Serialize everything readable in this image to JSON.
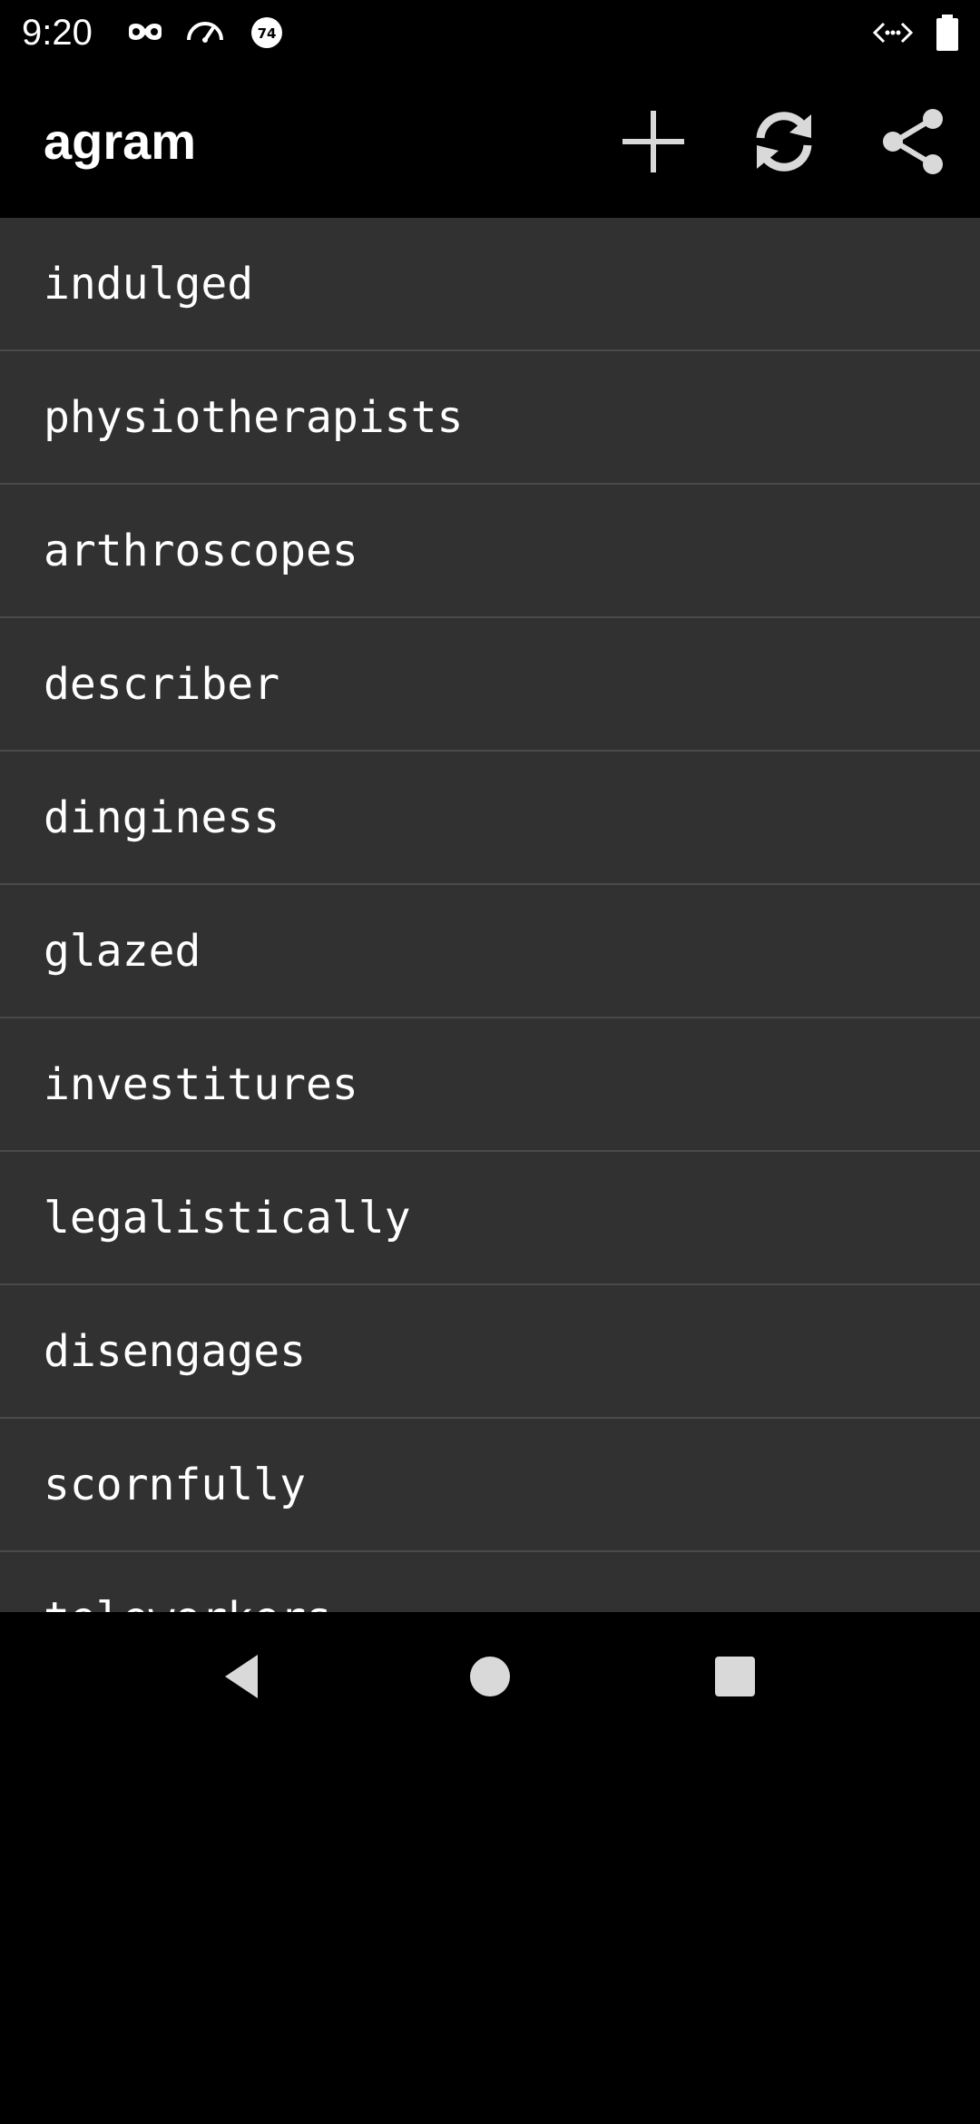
{
  "status_bar": {
    "time": "9:20",
    "icons": [
      "incognito-icon",
      "speedometer-icon",
      "notification-badge-icon",
      "code-icon",
      "battery-icon"
    ],
    "badge_text": "74"
  },
  "app_bar": {
    "title": "agram",
    "actions": [
      "add-icon",
      "refresh-icon",
      "share-icon"
    ]
  },
  "words": [
    "indulged",
    "physiotherapists",
    "arthroscopes",
    "describer",
    "dinginess",
    "glazed",
    "investitures",
    "legalistically",
    "disengages",
    "scornfully",
    "teleworkers"
  ],
  "nav_bar": {
    "buttons": [
      "back-icon",
      "home-icon",
      "recents-icon"
    ]
  },
  "colors": {
    "background": "#000000",
    "list_background": "#313131",
    "divider": "#4a4a4a",
    "text": "#ffffff",
    "icon": "#d9d9d9"
  }
}
